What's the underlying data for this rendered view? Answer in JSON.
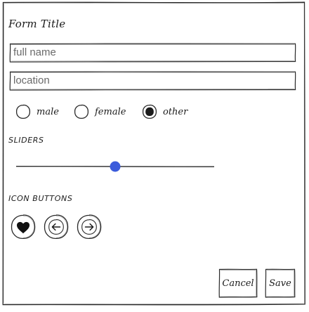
{
  "form": {
    "title": "Form Title"
  },
  "inputs": {
    "full_name": {
      "placeholder": "full name",
      "value": ""
    },
    "location": {
      "placeholder": "location",
      "value": ""
    }
  },
  "gender": {
    "options": [
      {
        "label": "male",
        "selected": false
      },
      {
        "label": "female",
        "selected": false
      },
      {
        "label": "other",
        "selected": true
      }
    ]
  },
  "sliders": {
    "label": "SLIDERS",
    "value_fraction": 0.5
  },
  "icon_buttons": {
    "label": "ICON BUTTONS",
    "items": [
      {
        "icon": "heart-icon"
      },
      {
        "icon": "arrow-left-icon"
      },
      {
        "icon": "arrow-right-icon"
      }
    ]
  },
  "actions": {
    "cancel_label": "Cancel",
    "save_label": "Save"
  },
  "colors": {
    "ink": "#222222",
    "slider_handle": "#3b5bdb"
  }
}
